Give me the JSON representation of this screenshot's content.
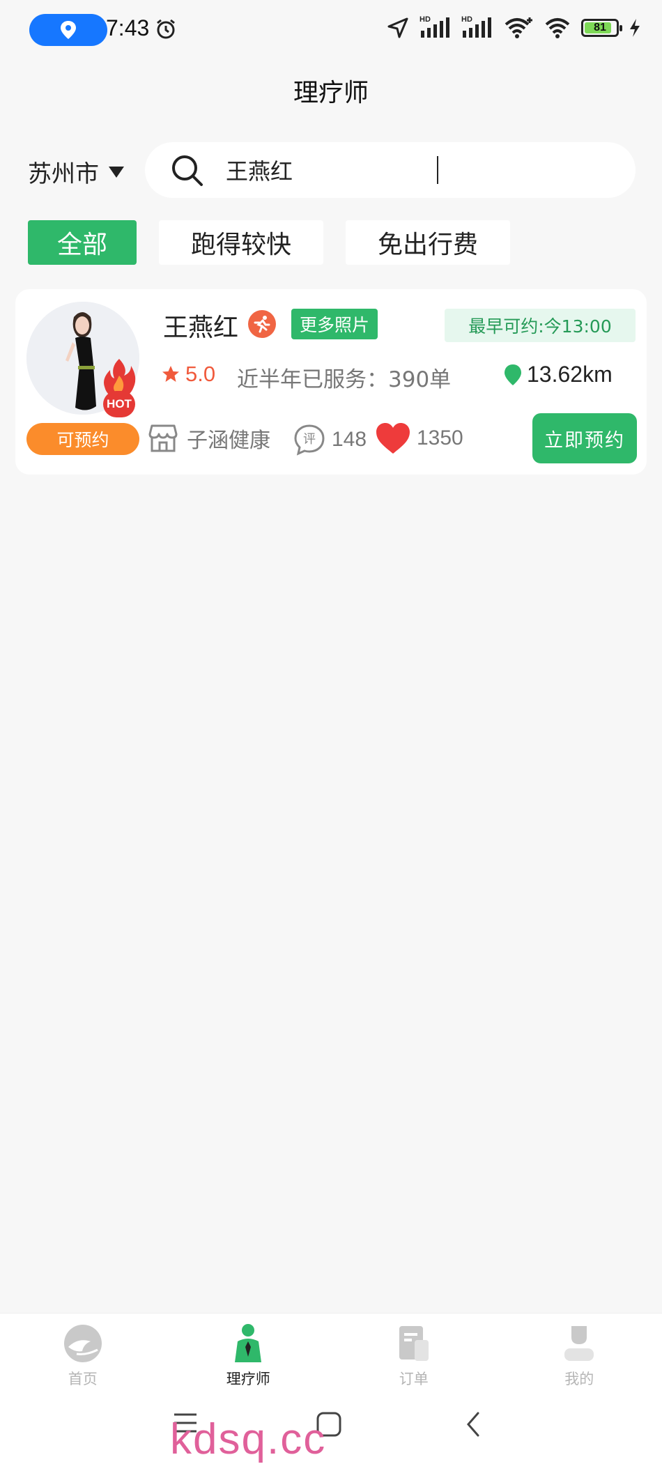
{
  "status_bar": {
    "time": "7:43",
    "battery": "81",
    "signal_1": "HD",
    "signal_2": "HD"
  },
  "header": {
    "title": "理疗师"
  },
  "location": {
    "city": "苏州市"
  },
  "search": {
    "value": "王燕红",
    "placeholder": ""
  },
  "filters": [
    {
      "label": "全部",
      "active": true
    },
    {
      "label": "跑得较快",
      "active": false
    },
    {
      "label": "免出行费",
      "active": false
    }
  ],
  "therapist": {
    "name": "王燕红",
    "hot_badge": "HOT",
    "more_photos": "更多照片",
    "earliest": "最早可约:今13:00",
    "rating": "5.0",
    "served": "近半年已服务：390单",
    "distance": "13.62km",
    "status": "可预约",
    "shop": "子涵健康",
    "comment_icon_text": "评",
    "comments": "148",
    "likes": "1350",
    "book_label": "立即预约"
  },
  "bottom_nav": [
    {
      "label": "首页",
      "icon": "home-icon",
      "active": false
    },
    {
      "label": "理疗师",
      "icon": "therapist-icon",
      "active": true
    },
    {
      "label": "订单",
      "icon": "order-icon",
      "active": false
    },
    {
      "label": "我的",
      "icon": "profile-icon",
      "active": false
    }
  ],
  "watermark": "kdsq.cc",
  "colors": {
    "accent_green": "#2fb86a",
    "orange": "#fb8c2b",
    "rating_red": "#f05a3c",
    "status_blue": "#1677ff"
  }
}
